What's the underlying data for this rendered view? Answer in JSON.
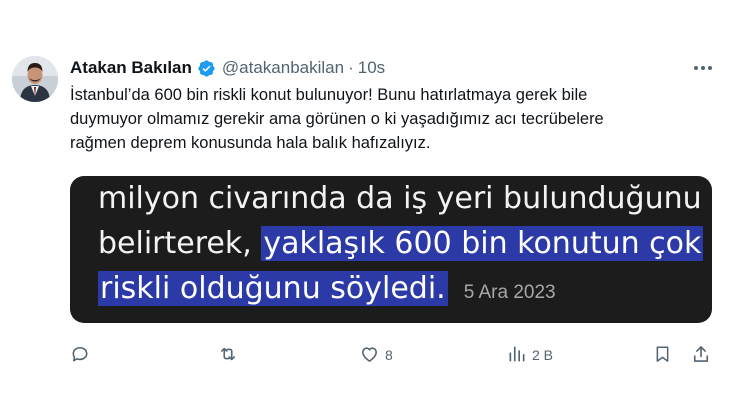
{
  "tweet": {
    "author_name": "Atakan Bakılan",
    "handle": "@atakanbakilan",
    "separator": "·",
    "time": "10s",
    "text_lines": [
      "İstanbul’da 600 bin riskli konut bulunuyor! Bunu hatırlatmaya gerek bile",
      "duymuyor olmamız gerekir ama görünen o ki yaşadığımız acı tecrübelere",
      "rağmen deprem konusunda hala balık hafızalıyız."
    ],
    "media": {
      "line1": "milyon civarında da iş yeri bulunduğunu",
      "line2_plain": "belirterek, ",
      "line2_highlight": "yaklaşık 600 bin konutun çok",
      "line3_highlight": "riskli olduğunu söyledi.",
      "date": "5 Ara 2023",
      "background_color": "#1c1c1c",
      "highlight_color": "#2b3aa6"
    },
    "icons": {
      "verified": "verified-badge-icon",
      "more": "more-icon"
    },
    "actions": {
      "reply": {
        "icon": "reply-icon",
        "count": ""
      },
      "retweet": {
        "icon": "retweet-icon",
        "count": ""
      },
      "like": {
        "icon": "heart-icon",
        "count": "8"
      },
      "views": {
        "icon": "views-icon",
        "count": "2 B"
      },
      "bookmark": {
        "icon": "bookmark-icon",
        "count": ""
      },
      "share": {
        "icon": "share-icon",
        "count": ""
      }
    },
    "colors": {
      "primary_text": "#0f1419",
      "secondary_text": "#536471",
      "verified_blue": "#1d9bf0"
    }
  }
}
